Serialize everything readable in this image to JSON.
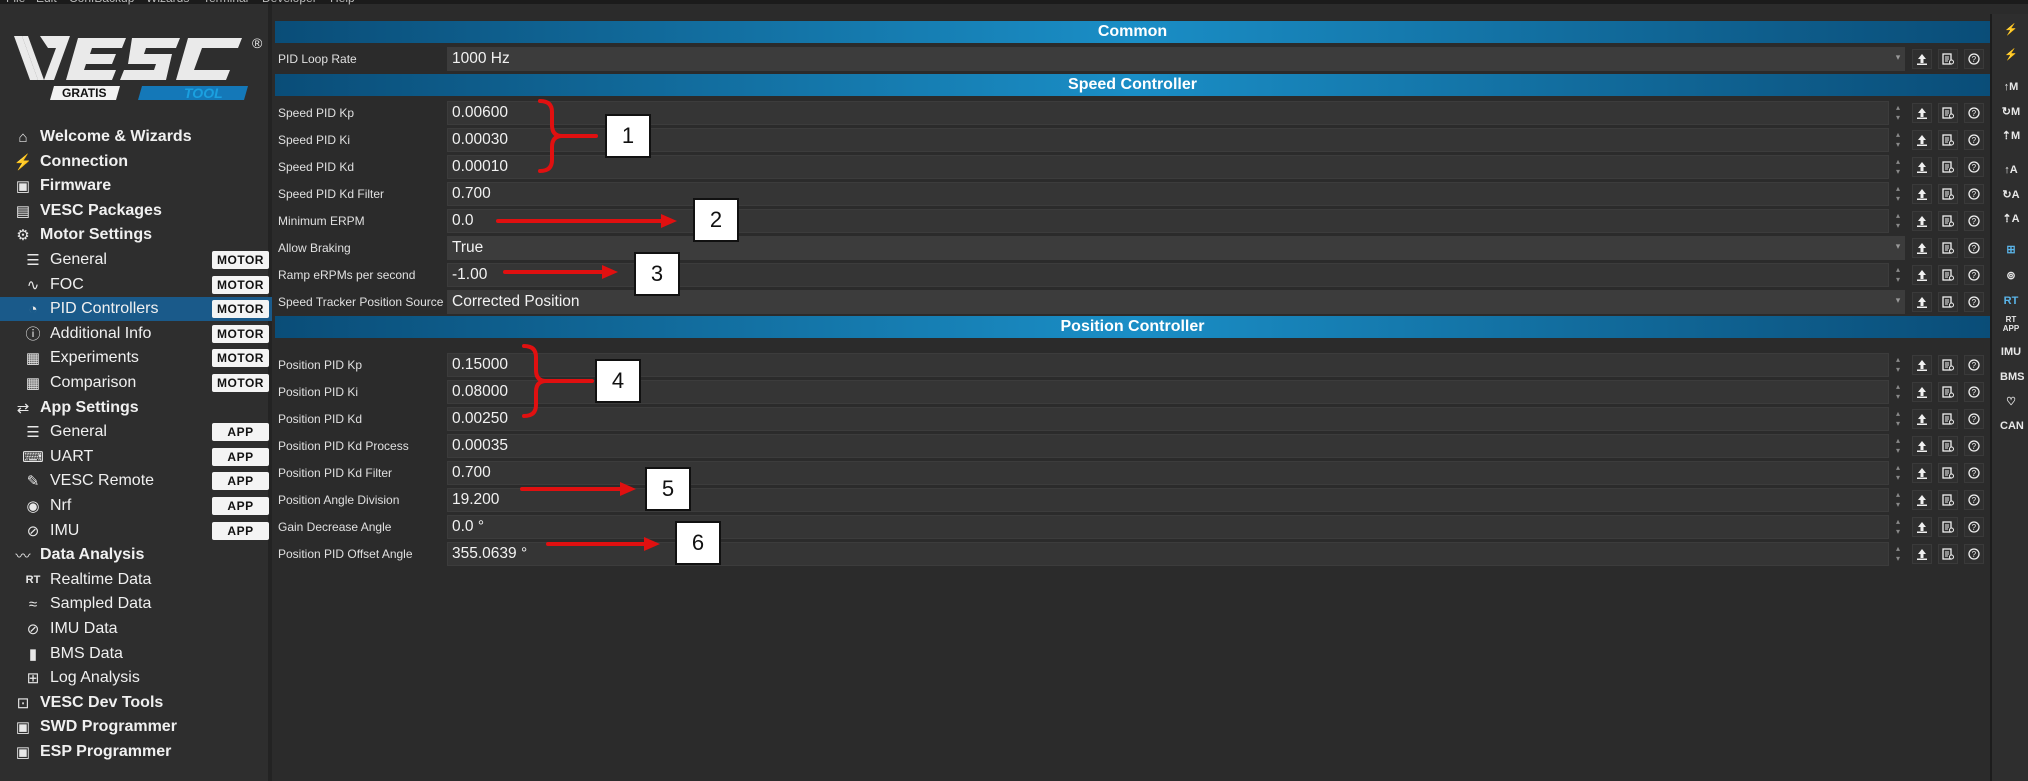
{
  "menubar": {
    "items": [
      "File",
      "Edit",
      "ConfBackup",
      "Wizards",
      "Terminal",
      "Developer",
      "Help"
    ]
  },
  "logo": {
    "brand": "VESC",
    "registered": "®",
    "left_tag": "GRATIS",
    "right_tag": "TOOL"
  },
  "sidebar": {
    "items": [
      {
        "label": "Welcome & Wizards",
        "icon": "home-icon",
        "level": "top"
      },
      {
        "label": "Connection",
        "icon": "plug-icon",
        "level": "top"
      },
      {
        "label": "Firmware",
        "icon": "chip-icon",
        "level": "top"
      },
      {
        "label": "VESC Packages",
        "icon": "package-icon",
        "level": "top"
      },
      {
        "label": "Motor Settings",
        "icon": "motor-icon",
        "level": "top"
      },
      {
        "label": "General",
        "icon": "sliders-icon",
        "level": "sub",
        "tag": "MOTOR"
      },
      {
        "label": "FOC",
        "icon": "foc-icon",
        "level": "sub",
        "tag": "MOTOR"
      },
      {
        "label": "PID Controllers",
        "icon": "gauge-icon",
        "level": "sub",
        "tag": "MOTOR",
        "active": true
      },
      {
        "label": "Additional Info",
        "icon": "info-icon",
        "level": "sub",
        "tag": "MOTOR"
      },
      {
        "label": "Experiments",
        "icon": "calculator-icon",
        "level": "sub",
        "tag": "MOTOR"
      },
      {
        "label": "Comparison",
        "icon": "calculator-icon",
        "level": "sub",
        "tag": "MOTOR"
      },
      {
        "label": "App Settings",
        "icon": "app-settings-icon",
        "level": "top"
      },
      {
        "label": "General",
        "icon": "sliders-icon",
        "level": "sub",
        "tag": "APP"
      },
      {
        "label": "UART",
        "icon": "keyboard-icon",
        "level": "sub",
        "tag": "APP"
      },
      {
        "label": "VESC Remote",
        "icon": "remote-icon",
        "level": "sub",
        "tag": "APP"
      },
      {
        "label": "Nrf",
        "icon": "wireless-icon",
        "level": "sub",
        "tag": "APP"
      },
      {
        "label": "IMU",
        "icon": "imu-icon",
        "level": "sub",
        "tag": "APP"
      },
      {
        "label": "Data Analysis",
        "icon": "chart-icon",
        "level": "top"
      },
      {
        "label": "Realtime Data",
        "icon": "realtime-icon",
        "level": "sub"
      },
      {
        "label": "Sampled Data",
        "icon": "sampled-icon",
        "level": "sub"
      },
      {
        "label": "IMU Data",
        "icon": "imu-icon",
        "level": "sub"
      },
      {
        "label": "BMS Data",
        "icon": "battery-icon",
        "level": "sub"
      },
      {
        "label": "Log Analysis",
        "icon": "map-icon",
        "level": "sub"
      },
      {
        "label": "VESC Dev Tools",
        "icon": "terminal-icon",
        "level": "top"
      },
      {
        "label": "SWD Programmer",
        "icon": "chip-icon",
        "level": "top"
      },
      {
        "label": "ESP Programmer",
        "icon": "chip-icon",
        "level": "top"
      }
    ]
  },
  "main": {
    "sections": [
      {
        "title": "Common"
      },
      {
        "title": "Speed Controller"
      },
      {
        "title": "Position Controller"
      }
    ],
    "rows": [
      {
        "label": "PID Loop Rate",
        "value": "1000 Hz",
        "kind": "combo"
      },
      {
        "label": "Speed PID Kp",
        "value": "0.00600",
        "kind": "spin"
      },
      {
        "label": "Speed PID Ki",
        "value": "0.00030",
        "kind": "spin"
      },
      {
        "label": "Speed PID Kd",
        "value": "0.00010",
        "kind": "spin"
      },
      {
        "label": "Speed PID Kd Filter",
        "value": "0.700",
        "kind": "spin"
      },
      {
        "label": "Minimum ERPM",
        "value": "0.0",
        "kind": "spin"
      },
      {
        "label": "Allow Braking",
        "value": "True",
        "kind": "combo"
      },
      {
        "label": "Ramp eRPMs per second",
        "value": "-1.00",
        "kind": "spin"
      },
      {
        "label": "Speed Tracker Position Source",
        "value": "Corrected Position",
        "kind": "combo"
      },
      {
        "label": "Position PID Kp",
        "value": "0.15000",
        "kind": "spin"
      },
      {
        "label": "Position PID Ki",
        "value": "0.08000",
        "kind": "spin"
      },
      {
        "label": "Position PID Kd",
        "value": "0.00250",
        "kind": "spin"
      },
      {
        "label": "Position PID Kd Process",
        "value": "0.00035",
        "kind": "spin"
      },
      {
        "label": "Position PID Kd Filter",
        "value": "0.700",
        "kind": "spin"
      },
      {
        "label": "Position Angle Division",
        "value": "19.200",
        "kind": "spin"
      },
      {
        "label": "Gain Decrease Angle",
        "value": "0.0 °",
        "kind": "spin"
      },
      {
        "label": "Position PID Offset Angle",
        "value": "355.0639 °",
        "kind": "spin"
      }
    ]
  },
  "annotations": {
    "labels": [
      "1",
      "2",
      "3",
      "4",
      "5",
      "6"
    ],
    "color": "#e01010"
  },
  "rightbar": {
    "tools": [
      {
        "label": "",
        "icon": "connect-icon"
      },
      {
        "label": "",
        "icon": "disconnect-icon"
      },
      {
        "label": "↑M",
        "icon": "read-motor-config-icon"
      },
      {
        "label": "↻M",
        "icon": "read-default-motor-config-icon"
      },
      {
        "label": "⇡M",
        "icon": "write-motor-config-icon"
      },
      {
        "label": "↑A",
        "icon": "read-app-config-icon"
      },
      {
        "label": "↻A",
        "icon": "read-default-app-config-icon"
      },
      {
        "label": "⇡A",
        "icon": "write-app-config-icon"
      },
      {
        "label": "",
        "icon": "can-bus-scan-icon"
      },
      {
        "label": "",
        "icon": "gamepad-icon"
      },
      {
        "label": "RT",
        "icon": "realtime-toggle-icon"
      },
      {
        "label": "RT APP",
        "icon": "realtime-app-icon"
      },
      {
        "label": "IMU",
        "icon": "imu-toggle-icon"
      },
      {
        "label": "BMS",
        "icon": "bms-toggle-icon"
      },
      {
        "label": "♡",
        "icon": "keepalive-icon"
      },
      {
        "label": "CAN",
        "icon": "can-forward-icon"
      }
    ]
  },
  "colors": {
    "section_header": "#1a8ec6",
    "active_nav": "#1a5a8a",
    "background": "#2b2b2b",
    "accent_logo": "#1aa0e0"
  }
}
